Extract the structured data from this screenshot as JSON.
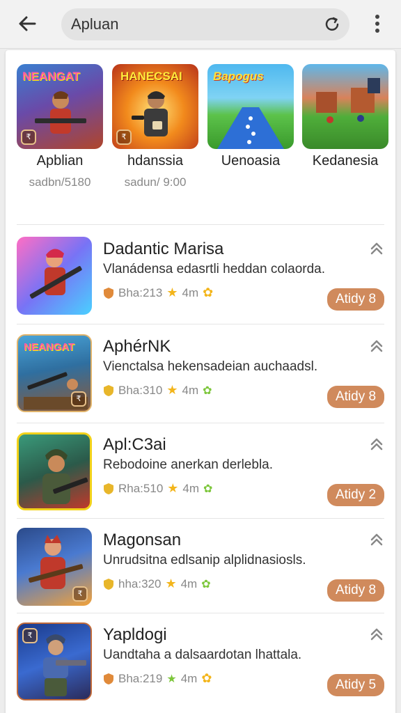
{
  "header": {
    "search_value": "Apluan"
  },
  "featured": [
    {
      "title": "Apblian",
      "subtitle": "sadbn/5180",
      "label": "NEANGAT"
    },
    {
      "title": "hdanssia",
      "subtitle": "sadun/ 9:00",
      "label": "HANECSAI"
    },
    {
      "title": "Uenoasia",
      "subtitle": "",
      "label": "Bapogus"
    },
    {
      "title": "Kedanesia",
      "subtitle": "",
      "label": ""
    }
  ],
  "apps": [
    {
      "title": "Dadantic Marisa",
      "description": "Vlanádensa edasrtli heddan colaorda.",
      "meta": "Bha:213",
      "rating": "4m",
      "button": "Atidy 8"
    },
    {
      "title": "AphérNK",
      "description": "Vienctalsa hekensadeian auchaadsl.",
      "meta": "Bha:310",
      "rating": "4m",
      "button": "Atidy 8"
    },
    {
      "title": "Apl:C3ai",
      "description": "Rebodoine anerkan derlebla.",
      "meta": "Rha:510",
      "rating": "4m",
      "button": "Atidy 2"
    },
    {
      "title": "Magonsan",
      "description": "Unrudsitna edlsanip alplidnasiosls.",
      "meta": "hha:320",
      "rating": "4m",
      "button": "Atidy 8"
    },
    {
      "title": "Yapldogi",
      "description": "Uandtaha a dalsaardotan lhattala.",
      "meta": "Bha:219",
      "rating": "4m",
      "button": "Atidy 5"
    }
  ],
  "colors": {
    "accent_button": "#d08a5c",
    "star": "#f3b51b",
    "green": "#7cc63a"
  }
}
